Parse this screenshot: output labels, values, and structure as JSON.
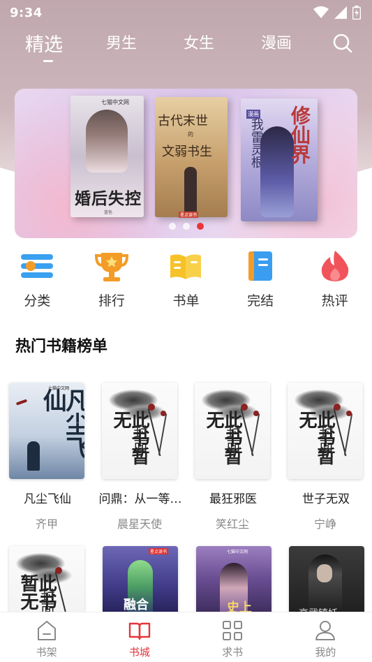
{
  "status_bar": {
    "time": "9:34"
  },
  "top_tabs": [
    {
      "label": "精选",
      "active": true
    },
    {
      "label": "男生",
      "active": false
    },
    {
      "label": "女生",
      "active": false
    },
    {
      "label": "漫画",
      "active": false
    }
  ],
  "banner": {
    "books": [
      {
        "title": "婚后失控",
        "logo": "七猫中文网",
        "author": "蓝色"
      },
      {
        "title_line1": "古代末世",
        "title_small": "的",
        "title_line2": "文弱书生",
        "tag": "星点读书"
      },
      {
        "title": "修仙界",
        "side_title": "我雷灵根",
        "badge": "漫画"
      }
    ],
    "dots": 3,
    "active_dot": 3
  },
  "categories": [
    {
      "label": "分类",
      "icon": "category-list-icon",
      "color": "#3aa0f0"
    },
    {
      "label": "排行",
      "icon": "trophy-icon",
      "color": "#f39c28"
    },
    {
      "label": "书单",
      "icon": "open-book-icon",
      "color": "#f6c228"
    },
    {
      "label": "完结",
      "icon": "bookmark-book-icon",
      "color": "#3a9df0"
    },
    {
      "label": "热评",
      "icon": "flame-icon",
      "color": "#f0545a"
    }
  ],
  "section": {
    "title": "热门书籍榜单"
  },
  "books_row1": [
    {
      "title": "凡尘飞仙",
      "author": "齐甲",
      "cover_text": "凡尘飞仙",
      "cover_logo": "七猫中文网"
    },
    {
      "title": "问鼎：从一等…",
      "author": "晨星天使",
      "cover_text1": "此书暂无",
      "cover_text2": "封面"
    },
    {
      "title": "最狂邪医",
      "author": "笑红尘",
      "cover_text1": "此书暂无",
      "cover_text2": "封面"
    },
    {
      "title": "世子无双",
      "author": "宁峥",
      "cover_text1": "此书暂无",
      "cover_text2": "封面"
    }
  ],
  "books_row2": [
    {
      "cover_text1": "此书暂无",
      "cover_text2": "封面"
    },
    {
      "cover_text": "融合",
      "cover_logo": "星点读书"
    },
    {
      "cover_text": "史上",
      "cover_logo": "七猫中文网"
    },
    {
      "cover_text": "高武镇妖"
    }
  ],
  "bottom_nav": [
    {
      "label": "书架",
      "icon": "bookshelf-icon",
      "active": false
    },
    {
      "label": "书城",
      "icon": "bookstore-icon",
      "active": true
    },
    {
      "label": "求书",
      "icon": "grid-request-icon",
      "active": false
    },
    {
      "label": "我的",
      "icon": "user-profile-icon",
      "active": false
    }
  ],
  "colors": {
    "accent": "#e5353b",
    "header_bg": "#c6b0b6"
  }
}
